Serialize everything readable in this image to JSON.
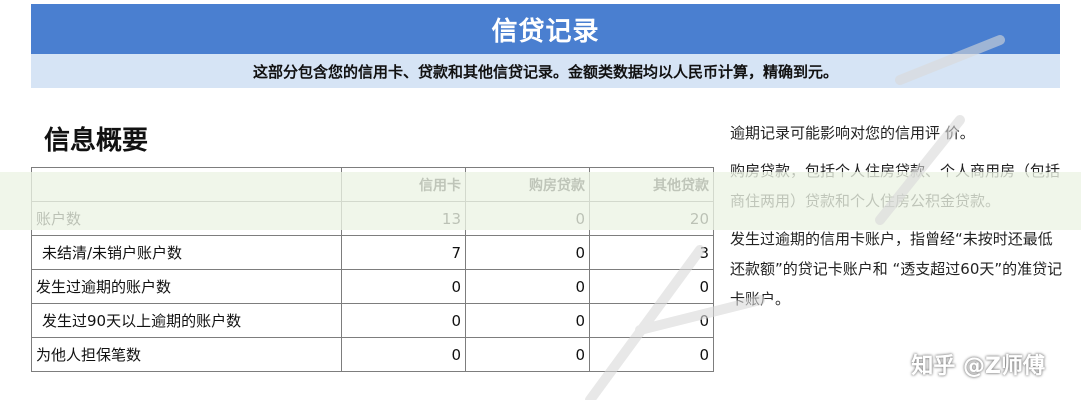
{
  "header": {
    "title": "信贷记录",
    "subtitle": "这部分包含您的信用卡、贷款和其他信贷记录。金额类数据均以人民币计算，精确到元。"
  },
  "section": {
    "title": "信息概要"
  },
  "table": {
    "columns": [
      "",
      "信用卡",
      "购房贷款",
      "其他贷款"
    ],
    "rows": [
      {
        "label": "账户数",
        "values": [
          "13",
          "0",
          "20"
        ]
      },
      {
        "label": "未结清/未销户账户数",
        "values": [
          "7",
          "0",
          "3"
        ]
      },
      {
        "label": "发生过逾期的账户数",
        "values": [
          "0",
          "0",
          "0"
        ]
      },
      {
        "label": "发生过90天以上逾期的账户数",
        "values": [
          "0",
          "0",
          "0"
        ]
      },
      {
        "label": "为他人担保笔数",
        "values": [
          "0",
          "0",
          "0"
        ]
      }
    ]
  },
  "notes": {
    "line1": "逾期记录可能影响对您的信用评 价。",
    "line2": "购房贷款，包括个人住房贷款、个人商用房（包括商住两用）贷款和个人住房公积金贷款。",
    "line3": "发生过逾期的信用卡账户，指曾经“未按时还最低还款额”的贷记卡账户和 “透支超过60天”的准贷记卡账户。"
  },
  "watermark": {
    "text": "知乎 @Z师傅"
  },
  "colors": {
    "title_bg": "#4a7fd0",
    "subtitle_bg": "#d6e4f5",
    "border": "#7d7d7d"
  }
}
